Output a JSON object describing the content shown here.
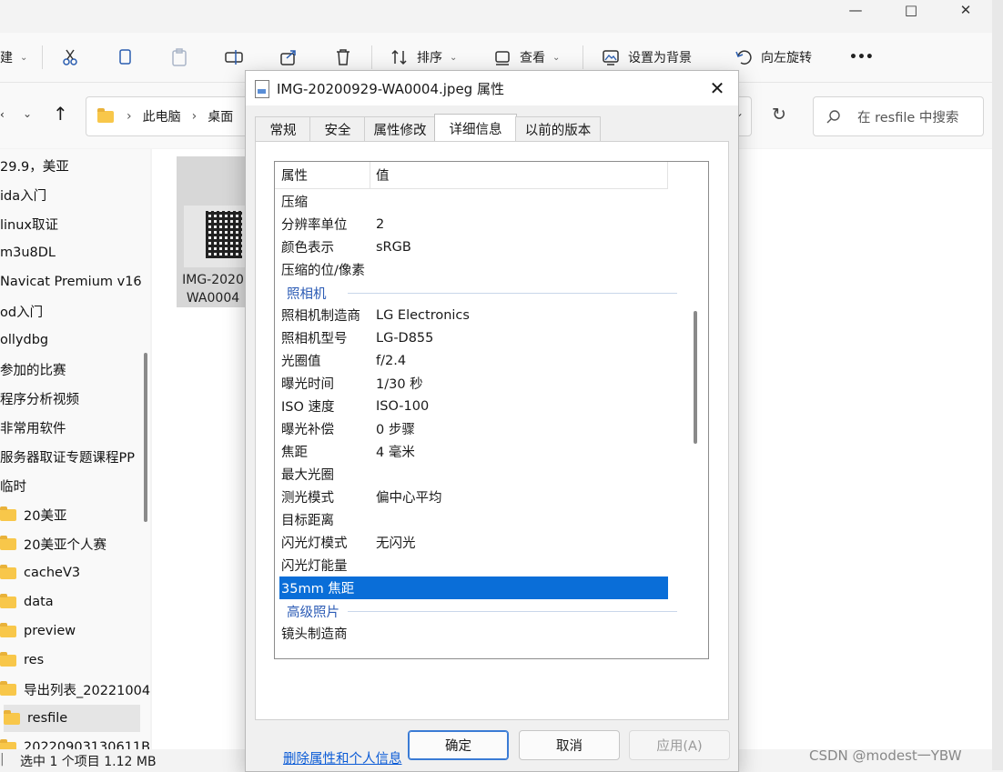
{
  "explorer": {
    "toolbar": {
      "new_label": "建",
      "sort_label": "排序",
      "view_label": "查看",
      "set_background_label": "设置为背景",
      "rotate_left_label": "向左旋转",
      "more_label": "•••"
    },
    "breadcrumb": [
      "此电脑",
      "桌面"
    ],
    "search_placeholder": "在 resfile 中搜索",
    "sidebar_items": [
      {
        "label": "29.9，美亚",
        "folder": false
      },
      {
        "label": "ida入门",
        "folder": false
      },
      {
        "label": "linux取证",
        "folder": false
      },
      {
        "label": "m3u8DL",
        "folder": false
      },
      {
        "label": "Navicat Premium v16",
        "folder": false
      },
      {
        "label": "od入门",
        "folder": false
      },
      {
        "label": "ollydbg",
        "folder": false
      },
      {
        "label": "参加的比赛",
        "folder": false
      },
      {
        "label": "程序分析视频",
        "folder": false
      },
      {
        "label": "非常用软件",
        "folder": false
      },
      {
        "label": "服务器取证专题课程PP",
        "folder": false
      },
      {
        "label": "临时",
        "folder": false
      },
      {
        "label": "20美亚",
        "folder": true
      },
      {
        "label": "20美亚个人赛",
        "folder": true
      },
      {
        "label": "cacheV3",
        "folder": true
      },
      {
        "label": "data",
        "folder": true
      },
      {
        "label": "preview",
        "folder": true
      },
      {
        "label": "res",
        "folder": true
      },
      {
        "label": "导出列表_20221004",
        "folder": true
      },
      {
        "label": "resfile",
        "folder": true
      },
      {
        "label": "20220903130611B",
        "folder": true
      }
    ],
    "file_tile": {
      "name_line1": "IMG-2020",
      "name_line2": "WA0004"
    },
    "status": "选中 1 个项目  1.12 MB",
    "watermark": "CSDN @modest一YBW"
  },
  "dialog": {
    "title": "IMG-20200929-WA0004.jpeg 属性",
    "tabs": [
      {
        "label": "常规",
        "active": false
      },
      {
        "label": "安全",
        "active": false
      },
      {
        "label": "属性修改",
        "active": false
      },
      {
        "label": "详细信息",
        "active": true
      },
      {
        "label": "以前的版本",
        "active": false
      }
    ],
    "columns": {
      "property": "属性",
      "value": "值"
    },
    "rows": [
      {
        "type": "row",
        "key": "压缩",
        "value": ""
      },
      {
        "type": "row",
        "key": "分辨率单位",
        "value": "2"
      },
      {
        "type": "row",
        "key": "颜色表示",
        "value": "sRGB"
      },
      {
        "type": "row",
        "key": "压缩的位/像素",
        "value": ""
      },
      {
        "type": "group",
        "key": "照相机"
      },
      {
        "type": "row",
        "key": "照相机制造商",
        "value": "LG Electronics"
      },
      {
        "type": "row",
        "key": "照相机型号",
        "value": "LG-D855"
      },
      {
        "type": "row",
        "key": "光圈值",
        "value": "f/2.4"
      },
      {
        "type": "row",
        "key": "曝光时间",
        "value": "1/30 秒"
      },
      {
        "type": "row",
        "key": "ISO 速度",
        "value": "ISO-100"
      },
      {
        "type": "row",
        "key": "曝光补偿",
        "value": "0 步骤"
      },
      {
        "type": "row",
        "key": "焦距",
        "value": "4 毫米"
      },
      {
        "type": "row",
        "key": "最大光圈",
        "value": ""
      },
      {
        "type": "row",
        "key": "测光模式",
        "value": "偏中心平均"
      },
      {
        "type": "row",
        "key": "目标距离",
        "value": ""
      },
      {
        "type": "row",
        "key": "闪光灯模式",
        "value": "无闪光"
      },
      {
        "type": "row",
        "key": "闪光灯能量",
        "value": ""
      },
      {
        "type": "row",
        "key": "35mm 焦距",
        "value": "",
        "selected": true
      },
      {
        "type": "group",
        "key": "高级照片"
      },
      {
        "type": "row",
        "key": "镜头制造商",
        "value": ""
      }
    ],
    "remove_link": "删除属性和个人信息",
    "buttons": {
      "ok": "确定",
      "cancel": "取消",
      "apply": "应用(A)"
    }
  }
}
